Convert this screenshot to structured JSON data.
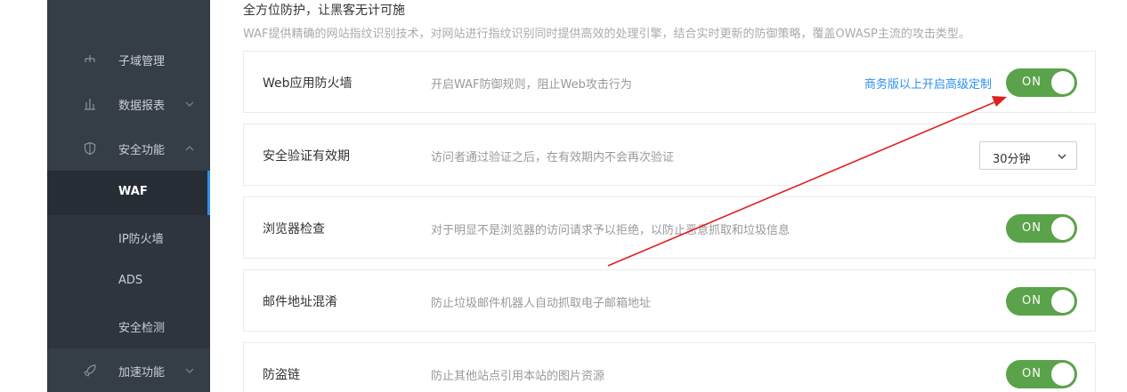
{
  "sidebar": {
    "items": [
      {
        "label": "子域管理",
        "icon": "sitemap-icon"
      },
      {
        "label": "数据报表",
        "icon": "bar-chart-icon"
      },
      {
        "label": "安全功能",
        "icon": "shield-icon"
      },
      {
        "label": "WAF"
      },
      {
        "label": "IP防火墙"
      },
      {
        "label": "ADS"
      },
      {
        "label": "安全检测"
      },
      {
        "label": "加速功能",
        "icon": "rocket-icon"
      }
    ]
  },
  "section": {
    "title": "全方位防护，让黑客无计可施",
    "description": "WAF提供精确的网站指纹识别技术，对网站进行指纹识别同时提供高效的处理引擎，结合实时更新的防御策略，覆盖OWASP主流的攻击类型。"
  },
  "settings": [
    {
      "name": "Web应用防火墙",
      "description": "开启WAF防御规则，阻止Web攻击行为",
      "link": "商务版以上开启高级定制",
      "toggle": "ON"
    },
    {
      "name": "安全验证有效期",
      "description": "访问者通过验证之后，在有效期内不会再次验证",
      "select_value": "30分钟"
    },
    {
      "name": "浏览器检查",
      "description": "对于明显不是浏览器的访问请求予以拒绝，以防止恶意抓取和垃圾信息",
      "toggle": "ON"
    },
    {
      "name": "邮件地址混淆",
      "description": "防止垃圾邮件机器人自动抓取电子邮箱地址",
      "toggle": "ON"
    },
    {
      "name": "防盗链",
      "description": "防止其他站点引用本站的图片资源",
      "toggle": "ON"
    }
  ],
  "colors": {
    "sidebar_bg": "#353d47",
    "accent": "#2d8ff0",
    "toggle_on": "#5aa34a",
    "annotation_arrow": "#e02020"
  }
}
